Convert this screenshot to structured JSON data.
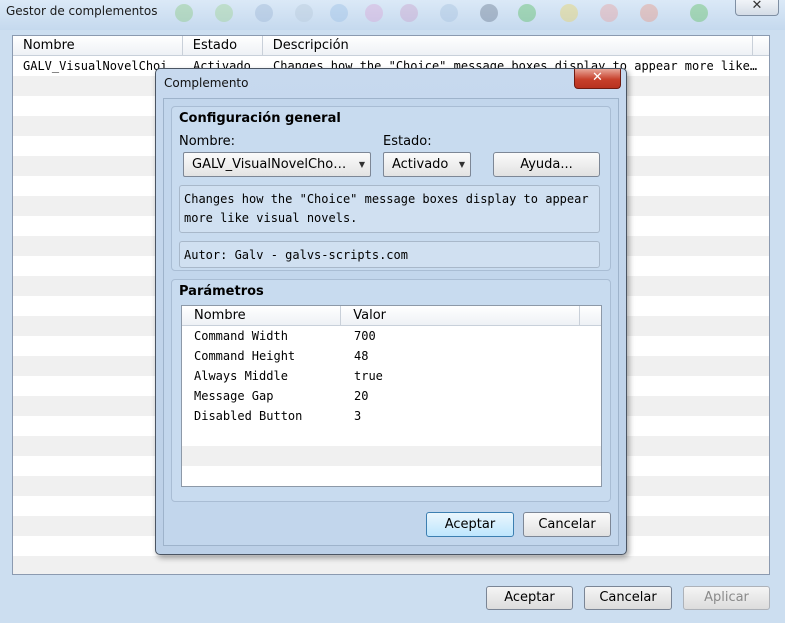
{
  "outer": {
    "title": "Gestor de complementos",
    "close_glyph": "✕",
    "columns": [
      "Nombre",
      "Estado",
      "Descripción"
    ],
    "rows": [
      {
        "name": "GALV_VisualNovelChoi…",
        "status": "Activado",
        "description": "Changes how the \"Choice\" message boxes display to appear more like…"
      }
    ],
    "buttons": {
      "ok": "Aceptar",
      "cancel": "Cancelar",
      "apply": "Aplicar"
    }
  },
  "dialog": {
    "title": "Complemento",
    "close_glyph": "✕",
    "general": {
      "title": "Configuración general",
      "name_label": "Nombre:",
      "name_value": "GALV_VisualNovelCho…",
      "status_label": "Estado:",
      "status_value": "Activado",
      "help_label": "Ayuda...",
      "description": "Changes how the \"Choice\" message boxes display to appear more like visual novels.",
      "author": "Autor: Galv - galvs-scripts.com"
    },
    "params": {
      "title": "Parámetros",
      "columns": [
        "Nombre",
        "Valor"
      ],
      "rows": [
        {
          "name": "Command Width",
          "value": "700"
        },
        {
          "name": "Command Height",
          "value": "48"
        },
        {
          "name": "Always Middle",
          "value": "true"
        },
        {
          "name": "Message Gap",
          "value": "20"
        },
        {
          "name": "Disabled Button",
          "value": "3"
        }
      ]
    },
    "buttons": {
      "ok": "Aceptar",
      "cancel": "Cancelar"
    }
  }
}
